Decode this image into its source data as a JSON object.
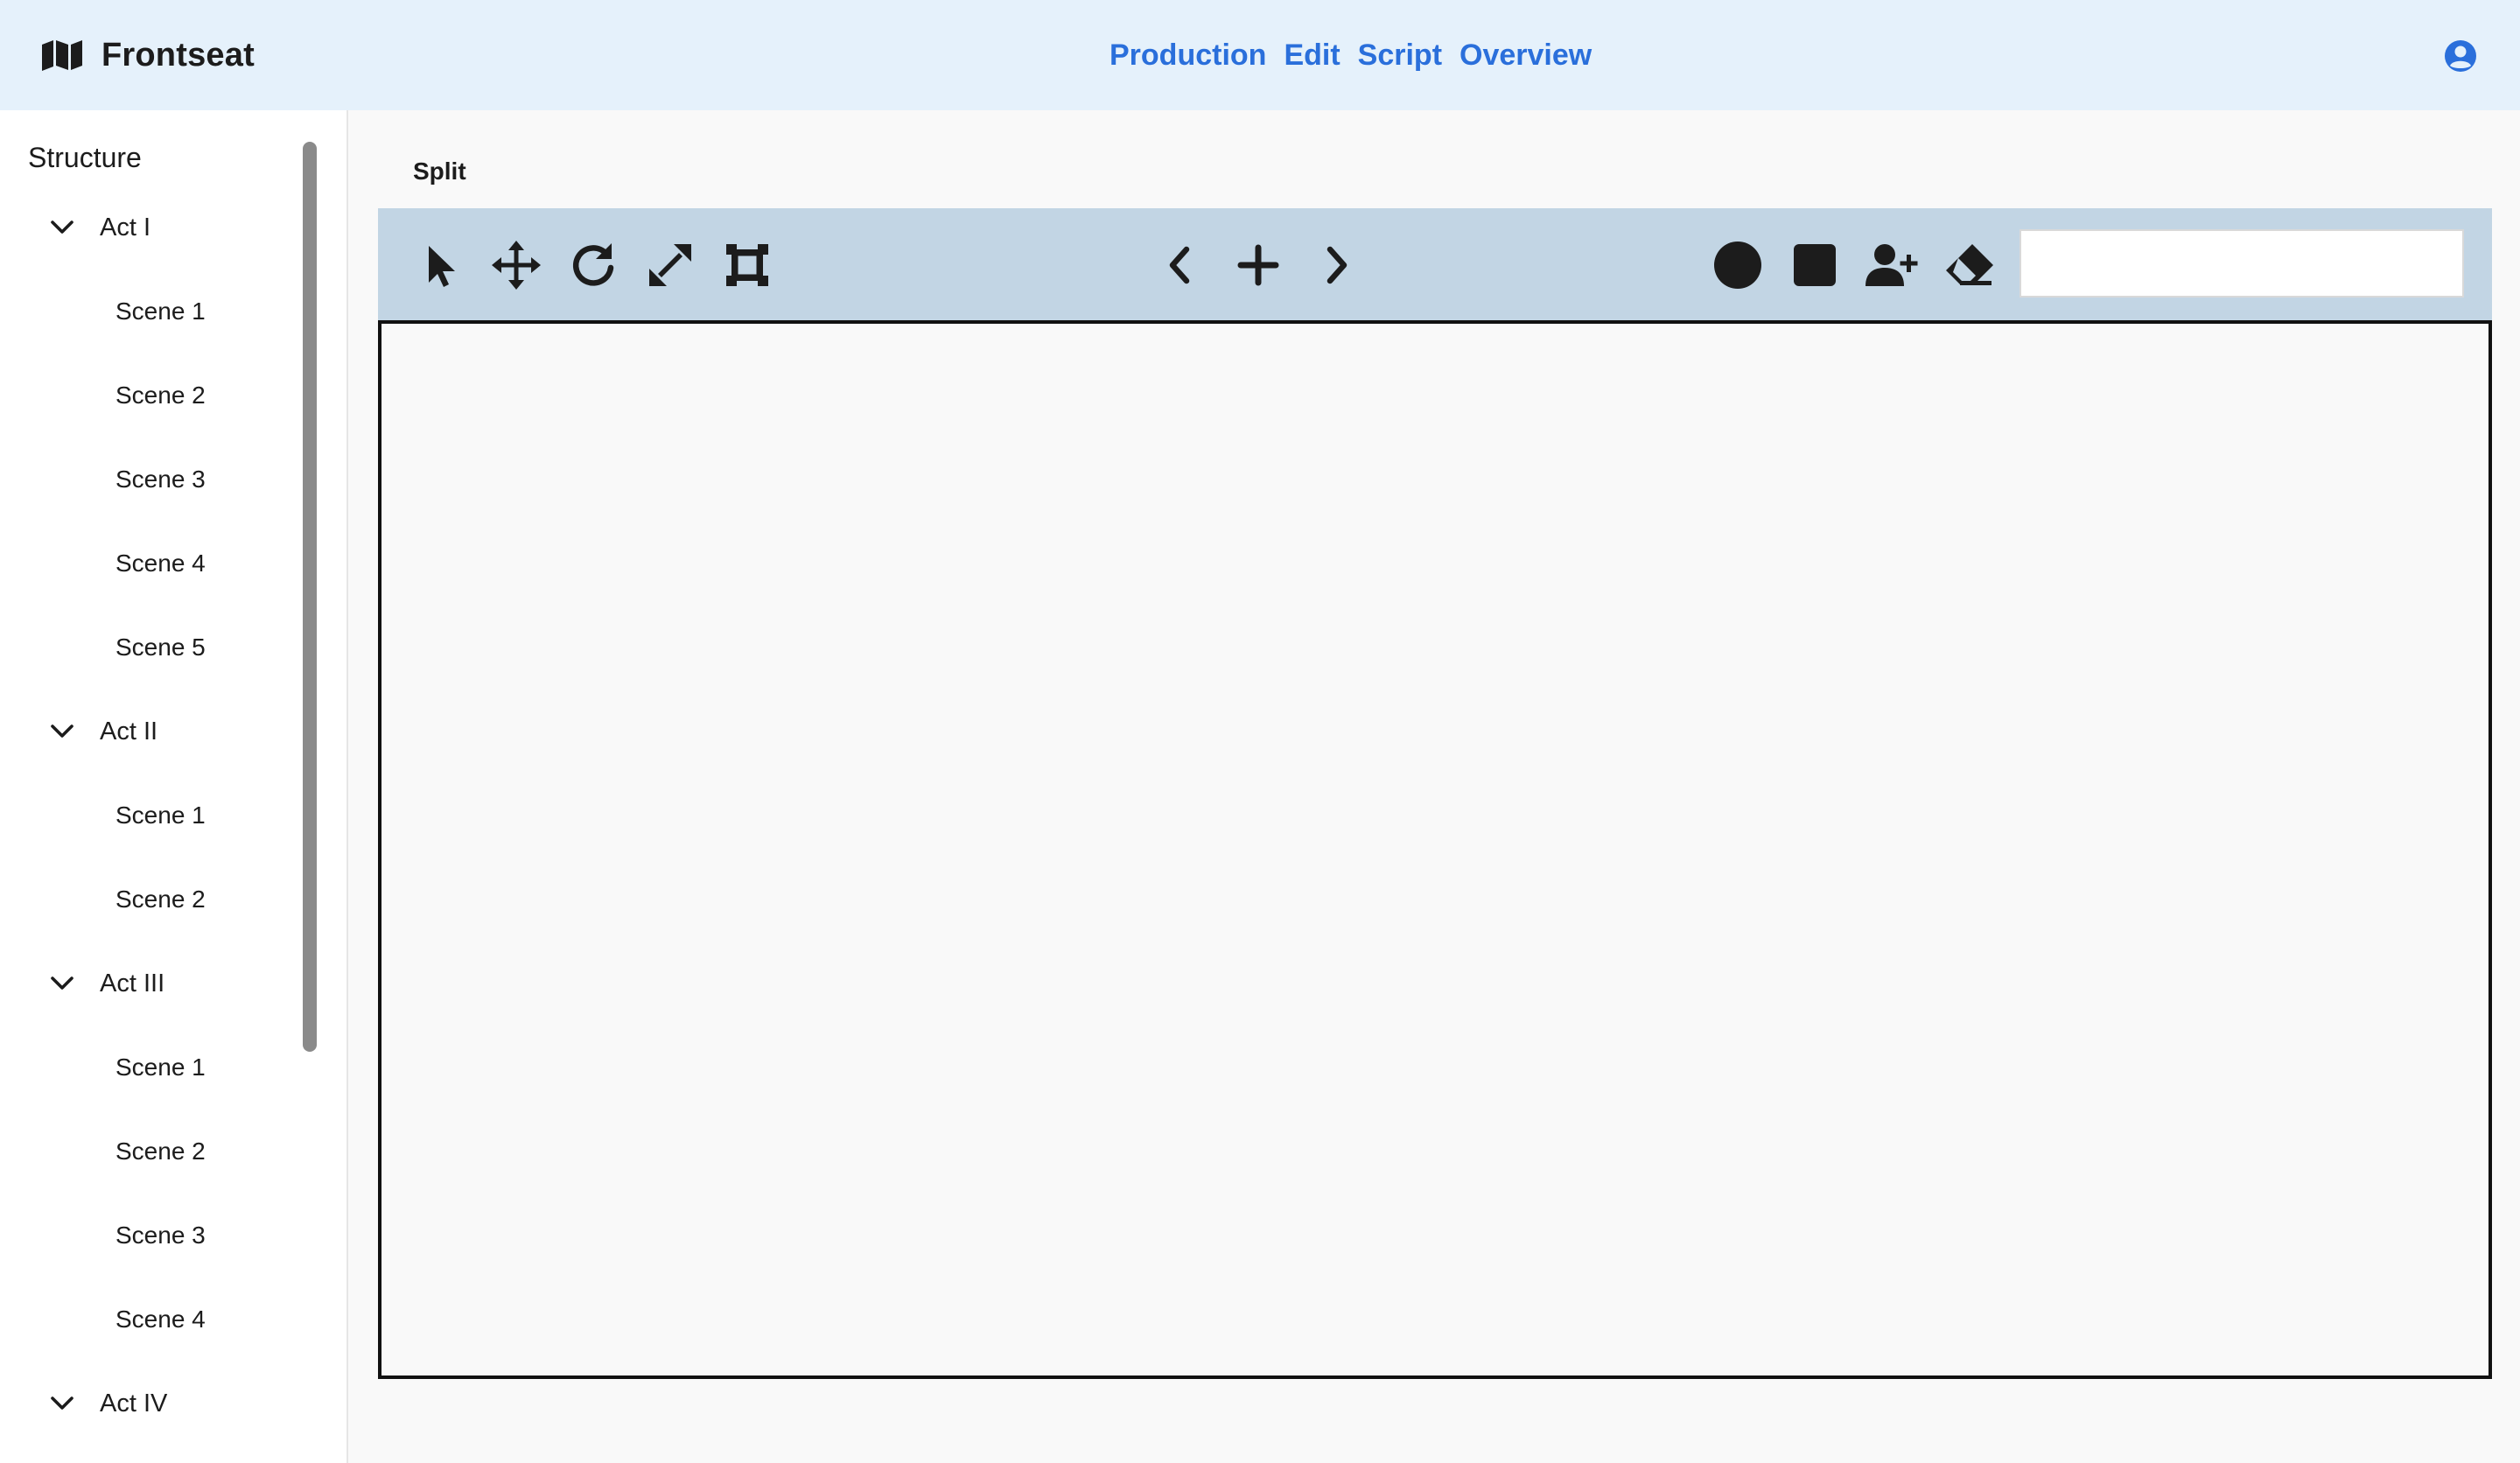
{
  "app": {
    "name": "Frontseat",
    "logo_icon": "map-icon"
  },
  "nav": {
    "items": [
      "Production",
      "Edit",
      "Script",
      "Overview"
    ],
    "color": "#2a6fdb"
  },
  "account": {
    "icon": "user-circle-icon"
  },
  "sidebar": {
    "title": "Structure",
    "acts": [
      {
        "label": "Act I",
        "expanded": true,
        "scenes": [
          "Scene 1",
          "Scene 2",
          "Scene 3",
          "Scene 4",
          "Scene 5"
        ]
      },
      {
        "label": "Act II",
        "expanded": true,
        "scenes": [
          "Scene 1",
          "Scene 2"
        ]
      },
      {
        "label": "Act III",
        "expanded": true,
        "scenes": [
          "Scene 1",
          "Scene 2",
          "Scene 3",
          "Scene 4"
        ]
      },
      {
        "label": "Act IV",
        "expanded": true,
        "scenes": []
      }
    ]
  },
  "main": {
    "tab": "Split",
    "toolbar": {
      "left_tools": [
        "pointer-icon",
        "move-icon",
        "rotate-icon",
        "resize-icon",
        "crop-frame-icon"
      ],
      "center_tools": [
        "chevron-left-icon",
        "plus-icon",
        "chevron-right-icon"
      ],
      "right_tools": [
        "circle-icon",
        "square-icon",
        "add-person-icon",
        "eraser-icon"
      ],
      "input_value": "",
      "input_placeholder": ""
    },
    "colors": {
      "toolbar_bg": "#c2d5e4",
      "header_bg": "#e5f1fb"
    }
  }
}
